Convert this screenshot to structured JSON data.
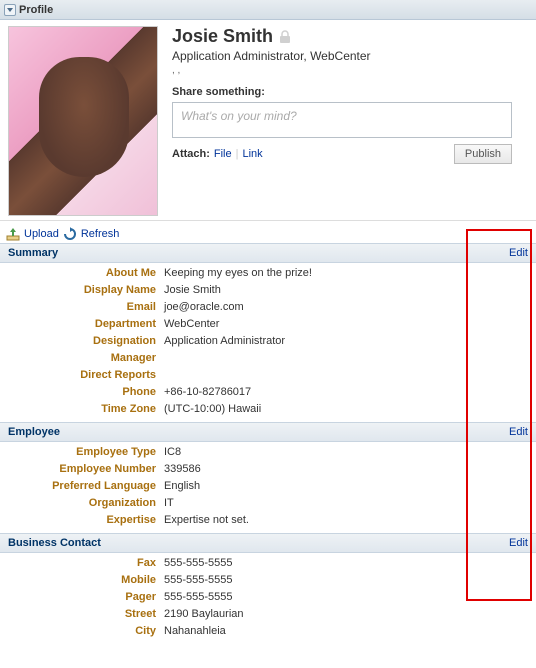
{
  "panel": {
    "title": "Profile"
  },
  "person": {
    "name": "Josie Smith",
    "role": "Application Administrator, WebCenter",
    "dots": ", ,"
  },
  "share": {
    "label": "Share something:",
    "placeholder": "What's on your mind?",
    "attach_label": "Attach:",
    "file_label": "File",
    "link_label": "Link",
    "publish_label": "Publish"
  },
  "toolbar": {
    "upload_label": "Upload",
    "refresh_label": "Refresh"
  },
  "sections": {
    "summary": {
      "title": "Summary",
      "edit": "Edit",
      "about_me": {
        "label": "About Me",
        "value": "Keeping my eyes on the prize!"
      },
      "display_name": {
        "label": "Display Name",
        "value": "Josie Smith"
      },
      "email": {
        "label": "Email",
        "value": "joe@oracle.com"
      },
      "department": {
        "label": "Department",
        "value": "WebCenter"
      },
      "designation": {
        "label": "Designation",
        "value": "Application Administrator"
      },
      "manager": {
        "label": "Manager",
        "value": ""
      },
      "direct_reports": {
        "label": "Direct Reports",
        "value": ""
      },
      "phone": {
        "label": "Phone",
        "value": "+86-10-82786017"
      },
      "time_zone": {
        "label": "Time Zone",
        "value": "(UTC-10:00) Hawaii"
      }
    },
    "employee": {
      "title": "Employee",
      "edit": "Edit",
      "type": {
        "label": "Employee Type",
        "value": "IC8"
      },
      "number": {
        "label": "Employee Number",
        "value": "339586"
      },
      "language": {
        "label": "Preferred Language",
        "value": "English"
      },
      "organization": {
        "label": "Organization",
        "value": "IT"
      },
      "expertise": {
        "label": "Expertise",
        "value": "Expertise not set."
      }
    },
    "business": {
      "title": "Business Contact",
      "edit": "Edit",
      "fax": {
        "label": "Fax",
        "value": "555-555-5555"
      },
      "mobile": {
        "label": "Mobile",
        "value": "555-555-5555"
      },
      "pager": {
        "label": "Pager",
        "value": "555-555-5555"
      },
      "street": {
        "label": "Street",
        "value": "2190 Baylaurian"
      },
      "city": {
        "label": "City",
        "value": "Nahanahleia"
      }
    }
  }
}
